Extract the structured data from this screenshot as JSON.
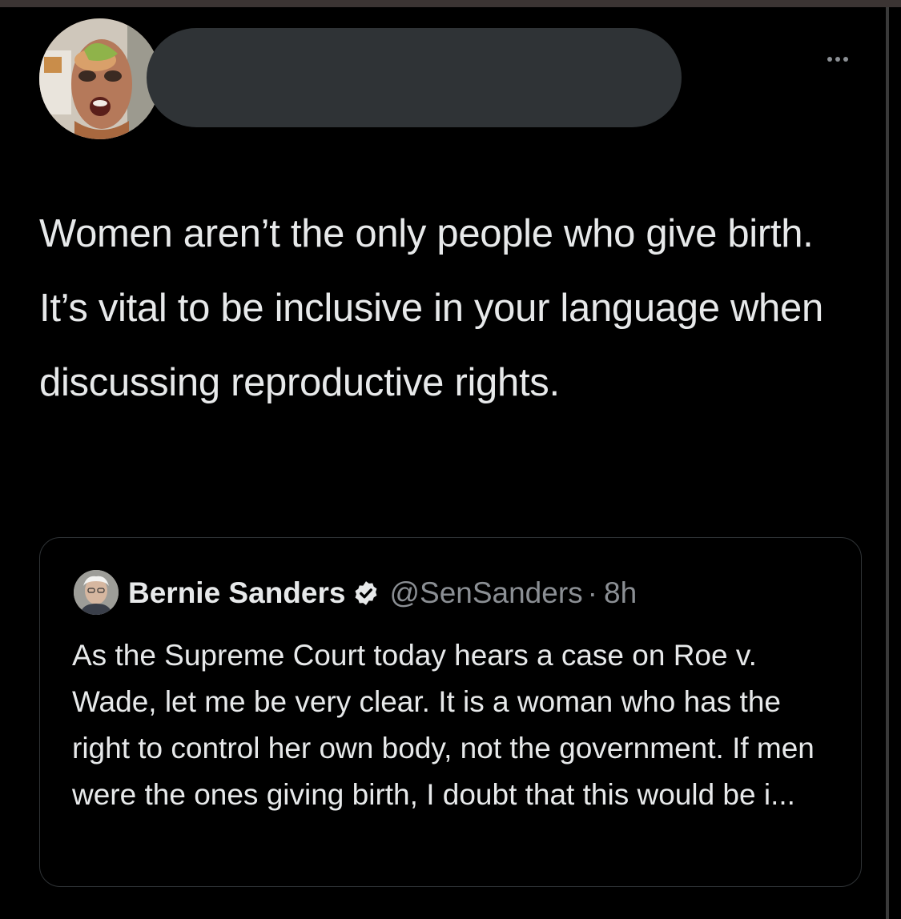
{
  "tweet": {
    "more_label": "...",
    "text": "Women aren’t the only people who give birth. It’s vital to be inclusive in your language when discussing reproductive rights."
  },
  "quoted_tweet": {
    "name": "Bernie Sanders",
    "verified": true,
    "handle": "@SenSanders",
    "separator": "·",
    "time": "8h",
    "text": "As the Supreme Court today hears a case on Roe v. Wade, let me be very clear. It is a woman who has the right to control her own body, not the government. If men were the ones giving birth, I doubt that this would be i..."
  },
  "icons": {
    "more": "more-horizontal-icon",
    "verified": "verified-badge-icon"
  },
  "colors": {
    "background": "#000000",
    "text_primary": "#e7e9ea",
    "text_secondary": "#8b8f94",
    "border": "#2f3336",
    "redaction": "#2f3336"
  }
}
